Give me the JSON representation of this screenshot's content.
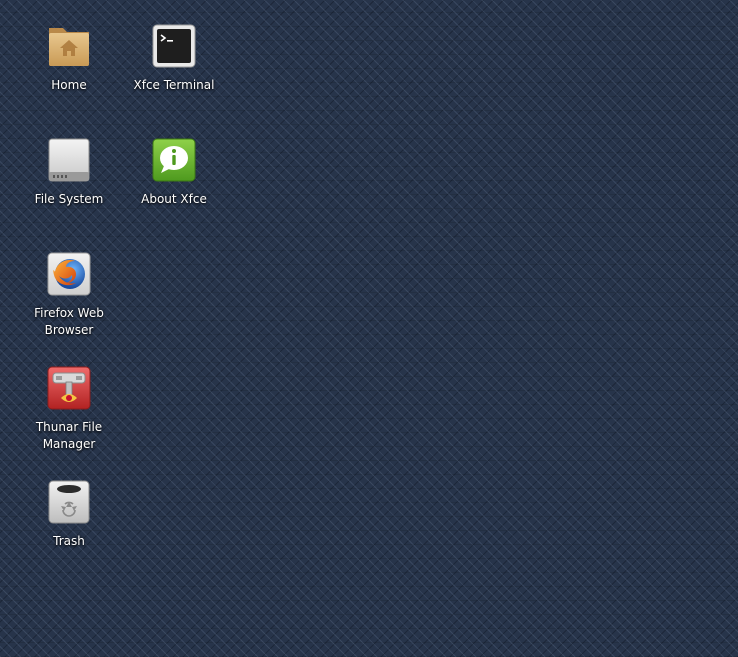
{
  "desktop": {
    "icons": [
      {
        "label": "Home",
        "icon": "home-folder-icon"
      },
      {
        "label": "Xfce Terminal",
        "icon": "terminal-icon"
      },
      {
        "label": "File System",
        "icon": "drive-icon"
      },
      {
        "label": "About Xfce",
        "icon": "info-icon"
      },
      {
        "label": "Firefox Web Browser",
        "icon": "firefox-icon"
      },
      {
        "label": "Thunar File Manager",
        "icon": "file-manager-icon"
      },
      {
        "label": "Trash",
        "icon": "trash-icon"
      }
    ]
  },
  "colors": {
    "background": "#27344a",
    "label_text": "#ffffff"
  }
}
